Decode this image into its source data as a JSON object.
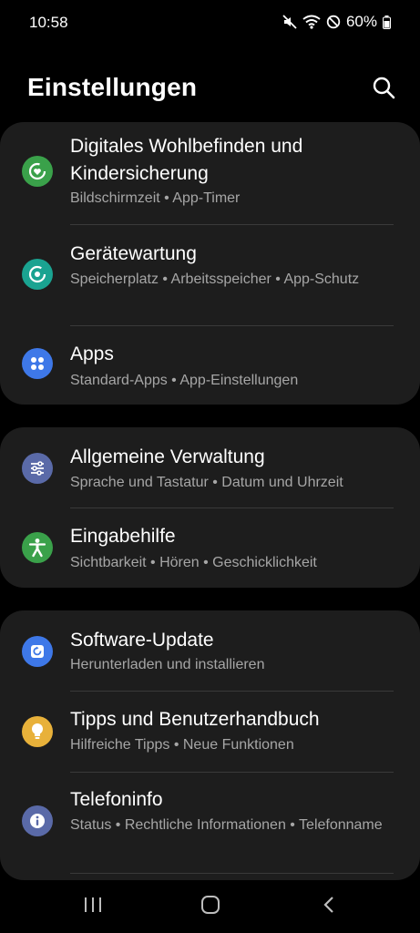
{
  "status": {
    "time": "10:58",
    "battery": "60%",
    "icons": [
      "mute-icon",
      "wifi-icon",
      "dnd-icon",
      "battery-icon"
    ]
  },
  "header": {
    "title": "Einstellungen"
  },
  "groups": [
    {
      "items": [
        {
          "title": "Digitales Wohlbefinden und Kindersicherung",
          "subtitle": "Bildschirmzeit  •  App-Timer",
          "icon": "wellbeing-icon",
          "color": "#3aa14a"
        },
        {
          "title": "Gerätewartung",
          "subtitle": "Speicherplatz  •  Arbeitsspeicher  •  App-Schutz",
          "icon": "device-care-icon",
          "color": "#1aa391"
        },
        {
          "title": "Apps",
          "subtitle": "Standard-Apps  •  App-Einstellungen",
          "icon": "apps-icon",
          "color": "#3e78e8"
        }
      ]
    },
    {
      "items": [
        {
          "title": "Allgemeine Verwaltung",
          "subtitle": "Sprache und Tastatur  •  Datum und Uhrzeit",
          "icon": "sliders-icon",
          "color": "#5a6aa8"
        },
        {
          "title": "Eingabehilfe",
          "subtitle": "Sichtbarkeit  •  Hören  •  Geschicklichkeit",
          "icon": "accessibility-icon",
          "color": "#3aa14a"
        }
      ]
    },
    {
      "items": [
        {
          "title": "Software-Update",
          "subtitle": "Herunterladen und installieren",
          "icon": "update-icon",
          "color": "#3e78e8"
        },
        {
          "title": "Tipps und Benutzerhandbuch",
          "subtitle": "Hilfreiche Tipps  •  Neue Funktionen",
          "icon": "lightbulb-icon",
          "color": "#e8b13a"
        },
        {
          "title": "Telefoninfo",
          "subtitle": "Status  •  Rechtliche Informationen  •  Telefonname",
          "icon": "info-icon",
          "color": "#5a6aa8"
        }
      ]
    }
  ],
  "navbar": {
    "buttons": [
      "recents-icon",
      "home-icon",
      "back-icon"
    ]
  }
}
